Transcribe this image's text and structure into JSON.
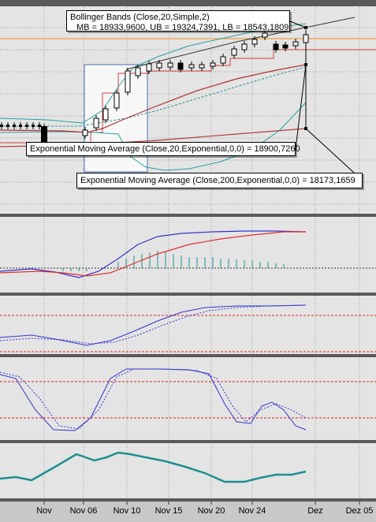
{
  "annotations": {
    "bollinger_line1": "Bollinger Bands (Close,20,Simple,2)",
    "bollinger_line2": "MB = 18933,9600, UB = 19324,7391, LB = 18543,1809",
    "ema20": "Exponential Moving Average (Close,20,Exponential,0,0) = 18900,7260",
    "ema200": "Exponential Moving Average (Close,200,Exponential,0,0) = 18173,1659"
  },
  "x_axis": {
    "ticks": [
      "Nov",
      "Nov 06",
      "Nov 10",
      "Nov 15",
      "Nov 20",
      "Nov 24",
      "Dez",
      "Dez 05"
    ]
  },
  "colors": {
    "background": "#e4e4e4",
    "grid": "#a0a0a0",
    "panel_divider": "#5a5a5a",
    "ema20": "#b03030",
    "ema200": "#b04040",
    "bollinger_middle": "#2e9090",
    "bollinger_outer": "#2aa0a0",
    "blue_line": "#3333cc",
    "red_line": "#e03030",
    "teal_line": "#1f8f8f",
    "level_dotted": "#dd2222",
    "orange_line": "#f0a040",
    "candle_up_fill": "#ffffff",
    "candle_down_fill": "#000000"
  },
  "chart_data": [
    {
      "type": "candlestick",
      "title": "",
      "candles": [
        {
          "x": "Nov 01",
          "o": 157,
          "c": 160,
          "h": 154,
          "l": 163,
          "dir": "down"
        },
        {
          "x": "Nov 02",
          "o": 158,
          "c": 161,
          "h": 155,
          "l": 164,
          "dir": "down"
        },
        {
          "x": "Nov 03",
          "o": 160,
          "c": 162,
          "h": 157,
          "l": 166,
          "dir": "down"
        },
        {
          "x": "Nov 04",
          "o": 163,
          "c": 181,
          "h": 160,
          "l": 184,
          "dir": "down"
        },
        {
          "x": "Nov 05",
          "o": 172,
          "c": 156,
          "h": 150,
          "l": 175,
          "dir": "up"
        },
        {
          "x": "Nov 06",
          "o": 159,
          "c": 139,
          "h": 137,
          "l": 160,
          "dir": "up"
        },
        {
          "x": "Nov 07",
          "o": 145,
          "c": 120,
          "h": 117,
          "l": 148,
          "dir": "up"
        },
        {
          "x": "Nov 08",
          "o": 123,
          "c": 88,
          "h": 85,
          "l": 127,
          "dir": "up"
        },
        {
          "x": "Nov 09",
          "o": 112,
          "c": 92,
          "h": 89,
          "l": 115,
          "dir": "up"
        },
        {
          "x": "Nov 10",
          "o": 90,
          "c": 84,
          "h": 82,
          "l": 93,
          "dir": "up"
        },
        {
          "x": "Nov 11",
          "o": 86,
          "c": 82,
          "h": 79,
          "l": 89,
          "dir": "up"
        },
        {
          "x": "Nov 12",
          "o": 82,
          "c": 86,
          "h": 78,
          "l": 89,
          "dir": "down"
        },
        {
          "x": "Nov 13",
          "o": 83,
          "c": 87,
          "h": 80,
          "l": 90,
          "dir": "down"
        },
        {
          "x": "Nov 14",
          "o": 85,
          "c": 86,
          "h": 82,
          "l": 89,
          "dir": "down"
        },
        {
          "x": "Nov 15",
          "o": 84,
          "c": 85,
          "h": 81,
          "l": 88,
          "dir": "up"
        },
        {
          "x": "Nov 16",
          "o": 85,
          "c": 82,
          "h": 79,
          "l": 87,
          "dir": "up"
        },
        {
          "x": "Nov 17",
          "o": 80,
          "c": 73,
          "h": 70,
          "l": 82,
          "dir": "up"
        },
        {
          "x": "Nov 18",
          "o": 73,
          "c": 66,
          "h": 63,
          "l": 75,
          "dir": "up"
        },
        {
          "x": "Nov 19",
          "o": 66,
          "c": 60,
          "h": 57,
          "l": 68,
          "dir": "up"
        },
        {
          "x": "Nov 20",
          "o": 60,
          "c": 54,
          "h": 51,
          "l": 62,
          "dir": "up"
        },
        {
          "x": "Nov 21",
          "o": 52,
          "c": 47,
          "h": 45,
          "l": 54,
          "dir": "up"
        },
        {
          "x": "Nov 22",
          "o": 47,
          "c": 42,
          "h": 40,
          "l": 50,
          "dir": "up"
        },
        {
          "x": "Nov 23",
          "o": 40,
          "c": 40,
          "h": 38,
          "l": 43,
          "dir": "up"
        },
        {
          "x": "Nov 24",
          "o": 55,
          "c": 58,
          "h": 52,
          "l": 61,
          "dir": "down"
        },
        {
          "x": "Nov 25",
          "o": 56,
          "c": 59,
          "h": 53,
          "l": 62,
          "dir": "down"
        },
        {
          "x": "Nov 26",
          "o": 59,
          "c": 56,
          "h": 54,
          "l": 61,
          "dir": "up"
        },
        {
          "x": "Nov 27",
          "o": 58,
          "c": 48,
          "h": 45,
          "l": 60,
          "dir": "up"
        }
      ]
    },
    {
      "type": "line",
      "title": "",
      "series": [
        {
          "name": "",
          "values": [
            340,
            339,
            341,
            344,
            348,
            352,
            347,
            340,
            326,
            316,
            305,
            300,
            297,
            295,
            295,
            294,
            294,
            294,
            294
          ]
        },
        {
          "name": "",
          "values": [
            345,
            344,
            344,
            345,
            348,
            350,
            350,
            346,
            340,
            331,
            323,
            316,
            310,
            306,
            302,
            299,
            296,
            295,
            294
          ]
        }
      ]
    },
    {
      "type": "line",
      "title": "",
      "series": [
        {
          "name": "",
          "values": [
            428,
            427,
            427,
            430,
            435,
            438,
            437,
            432,
            422,
            410,
            400,
            393,
            389,
            388,
            388,
            387,
            387,
            387,
            387
          ]
        },
        {
          "name": "",
          "values": [
            432,
            430,
            429,
            430,
            434,
            436,
            436,
            433,
            426,
            416,
            406,
            398,
            393,
            390,
            389,
            388,
            387,
            387,
            387
          ]
        }
      ]
    },
    {
      "type": "line",
      "title": "",
      "series": [
        {
          "name": "",
          "values": [
            475,
            480,
            522,
            545,
            546,
            530,
            480,
            470,
            467,
            468,
            469,
            470,
            480,
            530,
            537,
            515,
            510,
            525,
            544
          ]
        },
        {
          "name": "",
          "values": [
            472,
            478,
            505,
            540,
            546,
            543,
            505,
            475,
            468,
            468,
            469,
            472,
            478,
            515,
            540,
            522,
            512,
            520,
            530
          ]
        }
      ]
    },
    {
      "type": "area",
      "title": "",
      "series": [
        {
          "name": "",
          "values": [
            606,
            605,
            609,
            592,
            578,
            585,
            575,
            578,
            583,
            590,
            598,
            604,
            612,
            611,
            606,
            601,
            601,
            601,
            598
          ]
        }
      ]
    }
  ]
}
